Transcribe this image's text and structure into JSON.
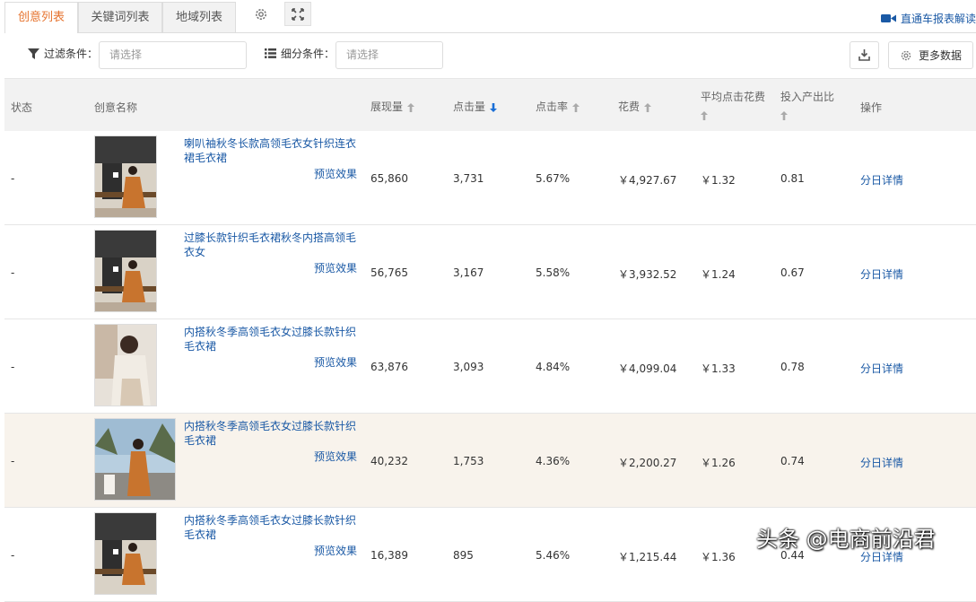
{
  "tabs": [
    {
      "label": "创意列表"
    },
    {
      "label": "关键词列表"
    },
    {
      "label": "地域列表"
    }
  ],
  "report_link": "直通车报表解读",
  "filter": {
    "label": "过滤条件：",
    "placeholder": "请选择"
  },
  "segment": {
    "label": "细分条件：",
    "placeholder": "请选择"
  },
  "more_data_label": "更多数据",
  "columns": {
    "status": "状态",
    "name": "创意名称",
    "impressions": "展现量",
    "clicks": "点击量",
    "ctr": "点击率",
    "cost": "花费",
    "avg_cpc": "平均点击花费",
    "roi": "投入产出比",
    "action": "操作"
  },
  "rows": [
    {
      "status": "-",
      "name": "喇叭袖秋冬长款高领毛衣女针织连衣裙毛衣裙",
      "preview": "预览效果",
      "impressions": "65,860",
      "clicks": "3,731",
      "ctr": "5.67%",
      "cost": "￥4,927.67",
      "avg_cpc": "￥1.32",
      "roi": "0.81",
      "action": "分日详情"
    },
    {
      "status": "-",
      "name": "过膝长款针织毛衣裙秋冬内搭高领毛衣女",
      "preview": "预览效果",
      "impressions": "56,765",
      "clicks": "3,167",
      "ctr": "5.58%",
      "cost": "￥3,932.52",
      "avg_cpc": "￥1.24",
      "roi": "0.67",
      "action": "分日详情"
    },
    {
      "status": "-",
      "name": "内搭秋冬季高领毛衣女过膝长款针织毛衣裙",
      "preview": "预览效果",
      "impressions": "63,876",
      "clicks": "3,093",
      "ctr": "4.84%",
      "cost": "￥4,099.04",
      "avg_cpc": "￥1.33",
      "roi": "0.78",
      "action": "分日详情"
    },
    {
      "status": "-",
      "name": "内搭秋冬季高领毛衣女过膝长款针织毛衣裙",
      "preview": "预览效果",
      "impressions": "40,232",
      "clicks": "1,753",
      "ctr": "4.36%",
      "cost": "￥2,200.27",
      "avg_cpc": "￥1.26",
      "roi": "0.74",
      "action": "分日详情"
    },
    {
      "status": "-",
      "name": "内搭秋冬季高领毛衣女过膝长款针织毛衣裙",
      "preview": "预览效果",
      "impressions": "16,389",
      "clicks": "895",
      "ctr": "5.46%",
      "cost": "￥1,215.44",
      "avg_cpc": "￥1.36",
      "roi": "0.44",
      "action": "分日详情"
    }
  ],
  "watermark": "头条 @电商前沿君",
  "colors": {
    "accent": "#e6732e",
    "link": "#1a59a5",
    "header_bg": "#f2f2f2",
    "highlight_row": "#f8f3ec"
  }
}
